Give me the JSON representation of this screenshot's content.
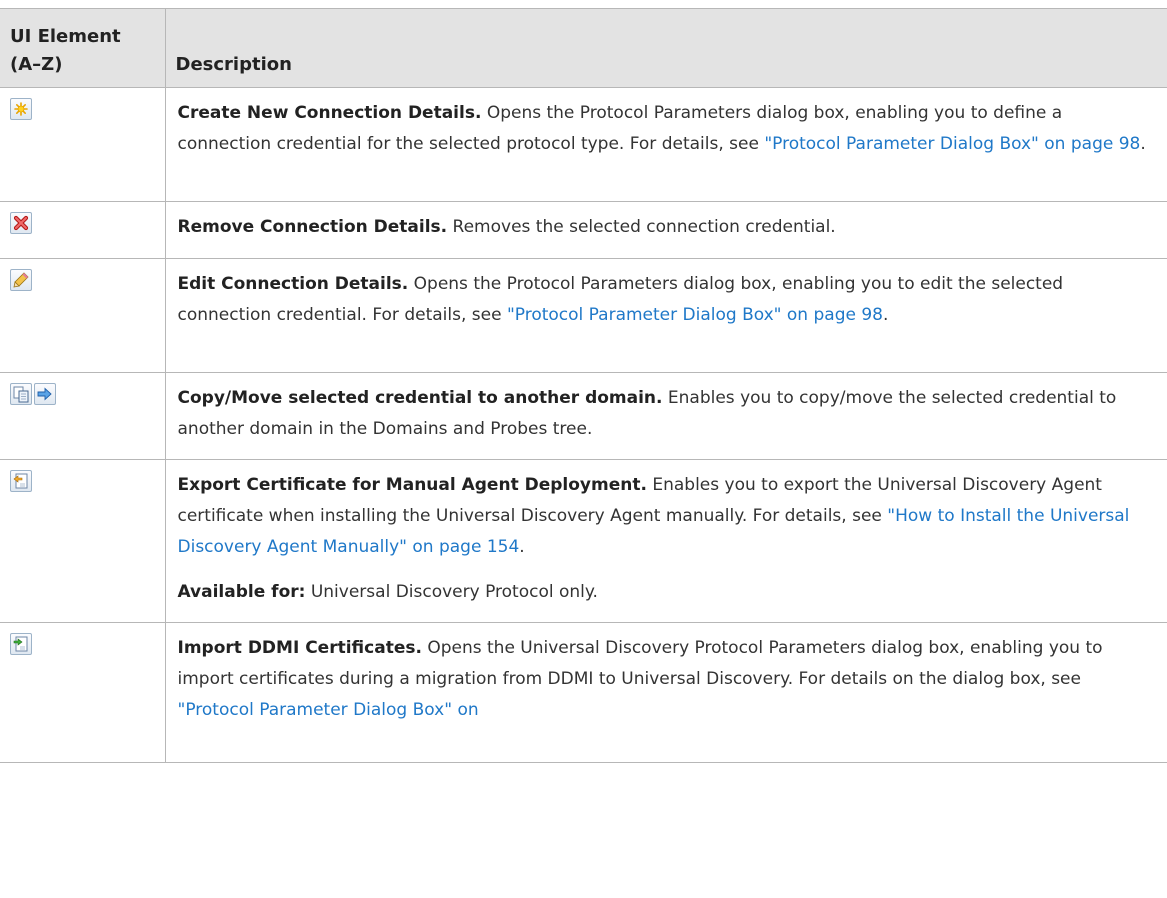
{
  "table": {
    "headers": {
      "element": "UI Element (A–Z)",
      "description": "Description"
    },
    "rows": [
      {
        "icons": [
          "new-connection-icon"
        ],
        "title": "Create New Connection Details.",
        "text1": " Opens the Protocol Parameters dialog box, enabling you to define a connection credential for the selected protocol type. For details, see ",
        "link": "\"Protocol Parameter Dialog Box\" on page 98",
        "text2": "."
      },
      {
        "icons": [
          "remove-icon"
        ],
        "title": "Remove Connection Details.",
        "text1": " Removes the selected connection credential."
      },
      {
        "icons": [
          "edit-pencil-icon"
        ],
        "title": "Edit Connection Details.",
        "text1": " Opens the Protocol Parameters dialog box, enabling you to edit the selected connection credential. For details, see ",
        "link": "\"Protocol Parameter Dialog Box\" on page 98",
        "text2": "."
      },
      {
        "icons": [
          "copy-icon",
          "move-arrow-icon"
        ],
        "title": "Copy/Move selected credential to another domain.",
        "text1": " Enables you to copy/move the selected credential to another domain in the Domains and Probes tree."
      },
      {
        "icons": [
          "export-certificate-icon"
        ],
        "title": "Export Certificate for Manual Agent Deployment.",
        "text1": " Enables you to export the Universal Discovery Agent certificate when installing the Universal Discovery Agent manually. For details, see ",
        "link": "\"How to Install the Universal Discovery Agent Manually\" on page 154",
        "text2": ".",
        "note_label": "Available for:",
        "note_text": " Universal Discovery Protocol only."
      },
      {
        "icons": [
          "import-certificate-icon"
        ],
        "title": "Import DDMI Certificates.",
        "text1": " Opens the Universal Discovery Protocol Parameters dialog box, enabling you to import certificates during a migration from DDMI to Universal Discovery. For details on the dialog box, see ",
        "link": "\"Protocol Parameter Dialog Box\" on"
      }
    ]
  }
}
